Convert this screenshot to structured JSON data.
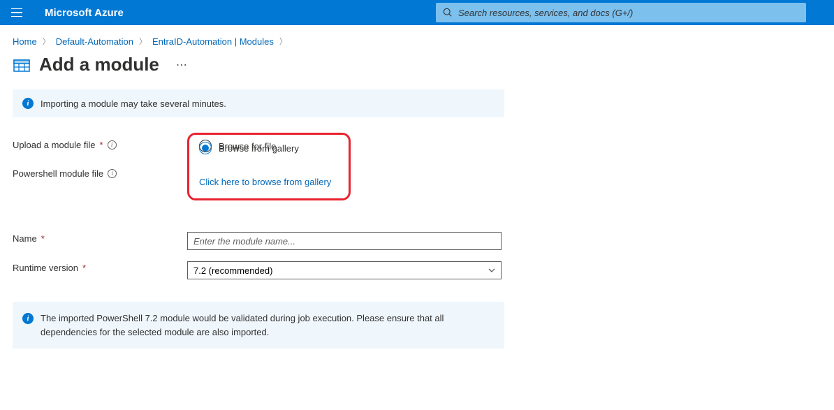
{
  "header": {
    "brand": "Microsoft Azure",
    "search_placeholder": "Search resources, services, and docs (G+/)"
  },
  "breadcrumb": {
    "items": [
      "Home",
      "Default-Automation",
      "EntraID-Automation | Modules"
    ]
  },
  "page": {
    "title": "Add a module"
  },
  "banner": {
    "top": "Importing a module may take several minutes.",
    "bottom": "The imported PowerShell 7.2 module would be validated during job execution. Please ensure that all dependencies for the selected module are also imported."
  },
  "form": {
    "upload_label": "Upload a module file",
    "radios": {
      "browse_file": "Browse for file",
      "browse_gallery": "Browse from gallery",
      "selected": "browse_gallery"
    },
    "ps_module_label": "Powershell module file",
    "gallery_link": "Click here to browse from gallery",
    "name_label": "Name",
    "name_placeholder": "Enter the module name...",
    "name_value": "",
    "runtime_label": "Runtime version",
    "runtime_value": "7.2 (recommended)"
  }
}
